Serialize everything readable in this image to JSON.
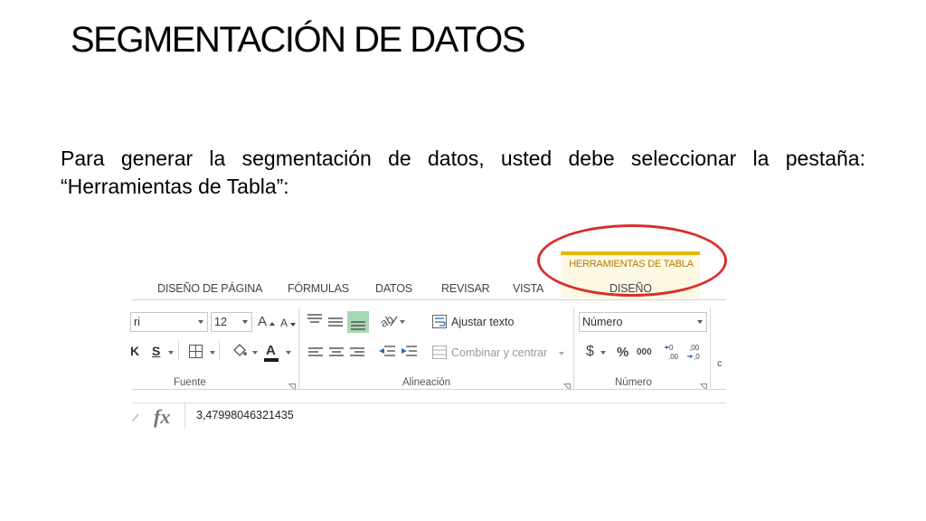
{
  "slide": {
    "title": "SEGMENTACIÓN DE DATOS",
    "body": "Para generar la segmentación de datos, usted debe seleccionar la pestaña: “Herramientas de Tabla”:"
  },
  "ribbon": {
    "context_title": "HERRAMIENTAS DE TABLA",
    "tabs": [
      "DISEÑO DE PÁGINA",
      "FÓRMULAS",
      "DATOS",
      "REVISAR",
      "VISTA",
      "DISEÑO"
    ],
    "font_name_partial": "ri",
    "font_size": "12",
    "bold_italic_partial": "K",
    "underline": "S",
    "font_color_letter": "A",
    "grow_font": "A",
    "shrink_font": "A",
    "wrap_text": "Ajustar texto",
    "merge_center": "Combinar y centrar",
    "number_format": "Número",
    "currency": "$",
    "percent": "%",
    "thousands": "000",
    "clipped_letter": "c",
    "groups": [
      "Fuente",
      "Alineación",
      "Número"
    ]
  },
  "formula_bar": {
    "fx_label": "fx",
    "value": "3,47998046321435"
  },
  "colors": {
    "contextual_accent": "#e6b700",
    "contextual_text": "#b57b00",
    "highlight_oval": "#d9302c",
    "selected_align": "#a7d8b5"
  }
}
